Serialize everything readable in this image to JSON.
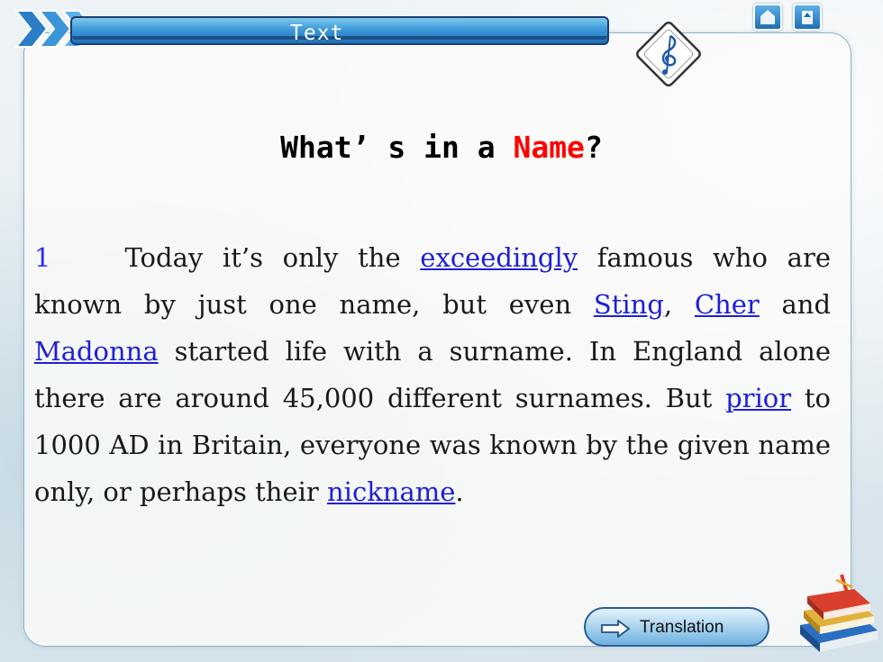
{
  "header": {
    "title": "Text"
  },
  "heading": {
    "part1": "What’ s in a ",
    "highlight": "Name",
    "part2": "?"
  },
  "paragraph": {
    "number": "1",
    "t1": "Today it’s only the ",
    "w1": "exceedingly",
    "t2": " famous who are known by just one name, but even ",
    "w2": "Sting",
    "t3": ", ",
    "w3": "Cher",
    "t4": " and ",
    "w4": "Madonna",
    "t5": " started life with a surname. In England alone there are around 45,000 different surnames. But ",
    "w5": "prior",
    "t6": " to 1000 AD in Britain, everyone was known by the given name only, or perhaps their ",
    "w6": "nickname",
    "t7": "."
  },
  "footer": {
    "translation_label": "Translation"
  },
  "icons": {
    "nav": "chevron-right-icon",
    "music": "music-note-icon",
    "home": "home-icon",
    "back": "back-icon",
    "arrow": "arrow-right-icon",
    "books": "books-icon"
  },
  "colors": {
    "highlight": "#ff0000",
    "link": "#1f1fd6",
    "bar": "#3e9ad8"
  }
}
